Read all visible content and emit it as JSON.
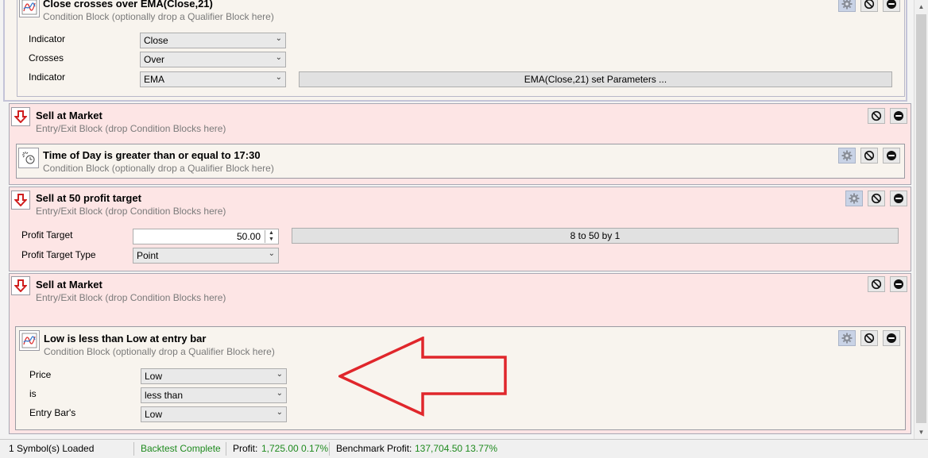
{
  "blocks": {
    "close_crosses": {
      "title": "Close crosses over EMA(Close,21)",
      "subtitle": "Condition Block (optionally drop a Qualifier Block here)",
      "fields": [
        {
          "label": "Indicator",
          "value": "Close"
        },
        {
          "label": "Crosses",
          "value": "Over"
        },
        {
          "label": "Indicator",
          "value": "EMA"
        }
      ],
      "param_button": "EMA(Close,21) set Parameters ..."
    },
    "sell_market_1": {
      "title": "Sell at Market",
      "subtitle": "Entry/Exit Block (drop Condition Blocks here)"
    },
    "time_of_day": {
      "title": "Time of Day is greater than or equal to 17:30",
      "subtitle": "Condition Block (optionally drop a Qualifier Block here)"
    },
    "profit_target": {
      "title": "Sell at 50 profit target",
      "subtitle": "Entry/Exit Block (drop Condition Blocks here)",
      "target_label": "Profit Target",
      "target_value": "50.00",
      "range_button": "8 to 50 by 1",
      "type_label": "Profit Target Type",
      "type_value": "Point"
    },
    "sell_market_2": {
      "title": "Sell at Market",
      "subtitle": "Entry/Exit Block (drop Condition Blocks here)"
    },
    "low_less": {
      "title": "Low is less than Low at entry bar",
      "subtitle": "Condition Block (optionally drop a Qualifier Block here)",
      "fields": [
        {
          "label": "Price",
          "value": "Low"
        },
        {
          "label": "is",
          "value": "less than"
        },
        {
          "label": "Entry Bar's",
          "value": "Low"
        }
      ]
    }
  },
  "icons": {
    "gear": "gear-icon",
    "disable": "disable-icon",
    "remove": "remove-icon",
    "sell": "sell-arrow-icon",
    "indicator": "indicator-icon",
    "clock": "clock-icon"
  },
  "colors": {
    "entry_bg": "#fde5e5",
    "cond_bg": "#f8f4ee",
    "sell_arrow": "#d01f1f",
    "annotation_arrow": "#e0262b",
    "status_green": "#1e8a1e"
  },
  "status": {
    "symbols": "1 Symbol(s) Loaded",
    "backtest": "Backtest Complete",
    "profit_label": "Profit:",
    "profit_value": "1,725.00 0.17%",
    "benchmark_label": "Benchmark Profit:",
    "benchmark_value": "137,704.50 13.77%"
  }
}
